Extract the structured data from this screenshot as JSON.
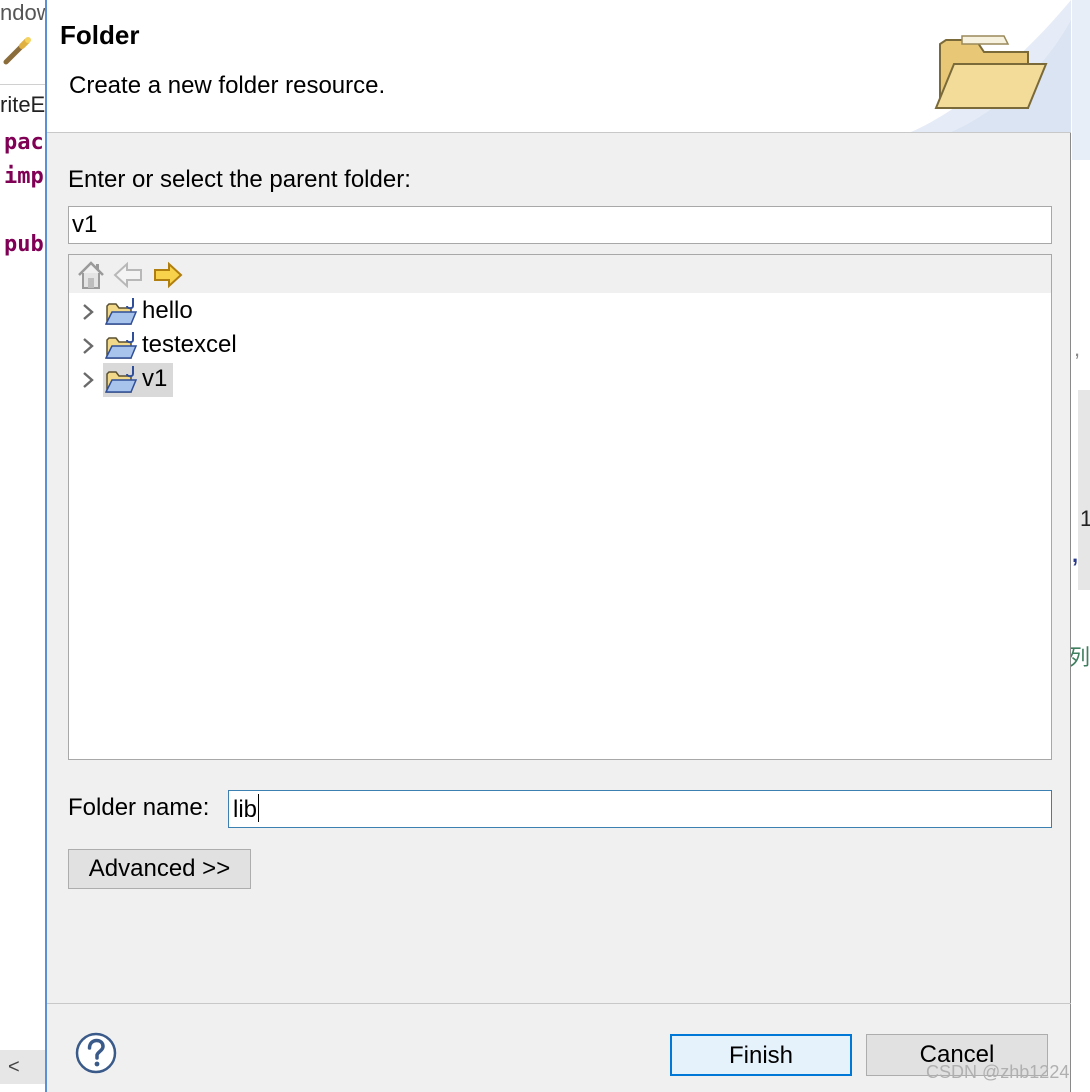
{
  "background": {
    "menu_text": "ndow",
    "editor_tab": "riteE",
    "code_lines": [
      "pac",
      "imp",
      "pub"
    ],
    "right_texts": [
      ",",
      "1",
      ",",
      "列"
    ],
    "scroll_left_arrow": "<"
  },
  "dialog": {
    "title": "Folder",
    "description": "Create a new folder resource.",
    "parent_label": "Enter or select the parent folder:",
    "parent_value": "v1",
    "tree": {
      "items": [
        {
          "label": "hello",
          "selected": false
        },
        {
          "label": "testexcel",
          "selected": false
        },
        {
          "label": "v1",
          "selected": true
        }
      ]
    },
    "folder_name_label": "Folder name:",
    "folder_name_value": "lib",
    "advanced_label": "Advanced >>",
    "finish_label": "Finish",
    "cancel_label": "Cancel",
    "help_icon": "question-icon"
  },
  "watermark": "CSDN @zhb1224",
  "colors": {
    "dialog_border": "#5b8fd6",
    "finish_border": "#0078d7",
    "keyword": "#7f0055"
  }
}
